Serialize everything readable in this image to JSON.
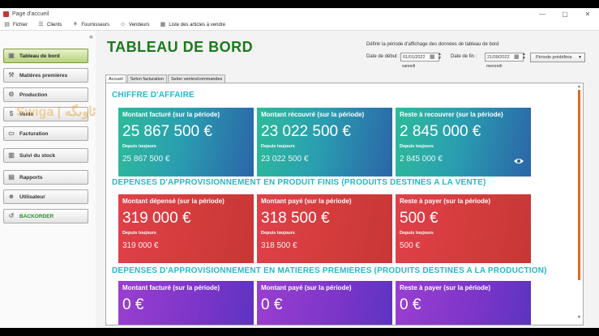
{
  "window": {
    "title": "Page d'accueil",
    "controls": [
      "—",
      "▢",
      "✕"
    ]
  },
  "menu": [
    {
      "label": "Fichier",
      "icon": "file-icon"
    },
    {
      "label": "Clients",
      "icon": "clients-icon"
    },
    {
      "label": "Fournisseurs",
      "icon": "suppliers-icon"
    },
    {
      "label": "Vendeurs",
      "icon": "sellers-icon"
    },
    {
      "label": "Liste des articles à vendre",
      "icon": "list-icon"
    }
  ],
  "sidebar": {
    "collapse_glyph": "«",
    "items": [
      {
        "label": "Tableau de bord",
        "icon": "dashboard-icon"
      },
      {
        "label": "Matières premières",
        "icon": "materials-icon"
      },
      {
        "label": "Production",
        "icon": "production-icon"
      },
      {
        "label": "Vente",
        "icon": "sale-icon"
      },
      {
        "label": "Facturation",
        "icon": "invoice-icon"
      },
      {
        "label": "Suivi du stock",
        "icon": "stock-icon"
      },
      {
        "label": "Rapports",
        "icon": "reports-icon"
      },
      {
        "label": "Utilisateur",
        "icon": "user-icon"
      },
      {
        "label": "BACKORDER",
        "icon": "backorder-icon"
      }
    ],
    "active_index": 0
  },
  "watermark": "Swiga | ئاوىگە",
  "header": {
    "title": "TABLEAU DE BORD",
    "period_label": "Définir la période d'affichage des données de tableau de bord",
    "start_label": "Date de début :",
    "start_value": "01/01/2022",
    "start_day": "samedi",
    "end_label": "Date de fin :",
    "end_value": "21/09/2022",
    "end_day": "mercredi",
    "preset_label": "Période prédéfinie",
    "preset_arrow": "▼"
  },
  "tabs": [
    {
      "label": "Accueil",
      "active": true
    },
    {
      "label": "Selon facturation",
      "active": false
    },
    {
      "label": "Selon ventes/commandes",
      "active": false
    }
  ],
  "sections": [
    {
      "title": "CHIFFRE D'AFFAIRE",
      "theme": "blue",
      "cards": [
        {
          "title": "Montant facturé (sur la période)",
          "value": "25 867 500 €",
          "since_label": "Depuis toujours",
          "since_value": "25 867 500 €"
        },
        {
          "title": "Montant récouvré (sur la période)",
          "value": "23 022 500 €",
          "since_label": "Depuis toujours",
          "since_value": "23 022 500 €"
        },
        {
          "title": "Reste à recouvrer (sur la période)",
          "value": "2 845 000 €",
          "since_label": "Depuis toujours",
          "since_value": "2 845 000 €"
        }
      ]
    },
    {
      "title": "DEPENSES D'APPROVISIONNEMENT EN PRODUIT FINIS (PRODUITS DESTINES A LA VENTE)",
      "theme": "red",
      "cards": [
        {
          "title": "Montant dépensé (sur la période)",
          "value": "319 000 €",
          "since_label": "Depuis toujours",
          "since_value": "319 000 €"
        },
        {
          "title": "Montant payé (sur la période)",
          "value": "318 500 €",
          "since_label": "Depuis toujours",
          "since_value": "318 500 €"
        },
        {
          "title": "Reste à payer (sur la période)",
          "value": "500 €",
          "since_label": "Depuis toujours",
          "since_value": "500 €"
        }
      ]
    },
    {
      "title": "DEPENSES D'APPROVISIONNEMENT EN MATIERES PREMIERES (PRODUITS DESTINES A LA PRODUCTION)",
      "theme": "purple",
      "cards": [
        {
          "title": "Montant facturé (sur la période)",
          "value": "0 €"
        },
        {
          "title": "Montant payé (sur la période)",
          "value": "0 €"
        },
        {
          "title": "Reste à payer (sur la période)",
          "value": "0 €"
        }
      ]
    }
  ],
  "colors": {
    "title_green": "#1a7a1a",
    "section_cyan": "#26b8c8",
    "scroll_orange": "#e06a1a"
  }
}
